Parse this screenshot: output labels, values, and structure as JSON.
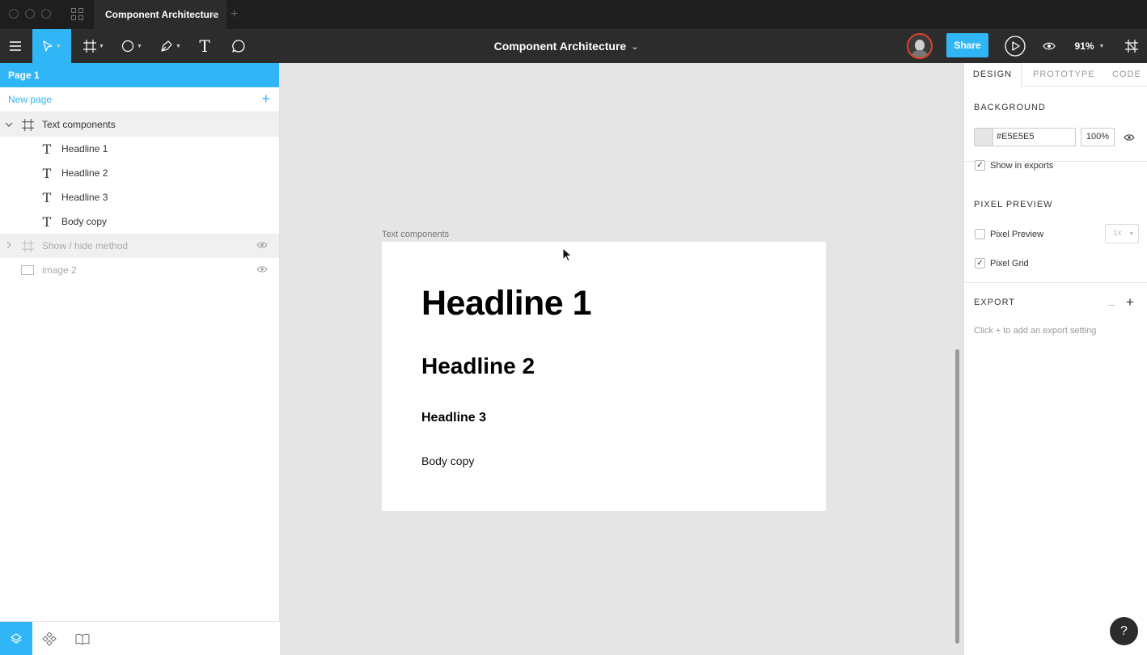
{
  "titlebar": {
    "tab_title": "Component Architecture",
    "tab_close": "×",
    "new_tab": "+"
  },
  "toolbar": {
    "file_title": "Component Architecture",
    "file_title_caret": "⌄",
    "share_label": "Share",
    "zoom_label": "91%",
    "accent_color": "#30B6F7"
  },
  "sidebar": {
    "page_label": "Page 1",
    "new_page_label": "New page",
    "layers": [
      {
        "label": "Text components",
        "type": "frame",
        "expanded": true
      },
      {
        "label": "Headline 1",
        "type": "text"
      },
      {
        "label": "Headline 2",
        "type": "text"
      },
      {
        "label": "Headline 3",
        "type": "text"
      },
      {
        "label": "Body copy",
        "type": "text"
      },
      {
        "label": "Show / hide method",
        "type": "frame",
        "expanded": false,
        "hidden": true
      },
      {
        "label": "image 2",
        "type": "image",
        "hidden": true
      }
    ]
  },
  "canvas": {
    "frame_label": "Text components",
    "headline_1": "Headline 1",
    "headline_2": "Headline 2",
    "headline_3": "Headline 3",
    "body_copy": "Body copy"
  },
  "design_panel": {
    "tabs": [
      "DESIGN",
      "PROTOTYPE",
      "CODE"
    ],
    "active_tab": "DESIGN",
    "background": {
      "title": "BACKGROUND",
      "hex": "#E5E5E5",
      "opacity": "100%",
      "show_in_exports_label": "Show in exports",
      "show_in_exports": true
    },
    "pixel_preview": {
      "title": "PIXEL PREVIEW",
      "pixel_preview_label": "Pixel Preview",
      "pixel_preview_checked": false,
      "scale": "1x",
      "pixel_grid_label": "Pixel Grid",
      "pixel_grid_checked": true
    },
    "export": {
      "title": "EXPORT",
      "hint": "Click + to add an export setting",
      "minus": "–",
      "plus": "+"
    }
  },
  "help_label": "?"
}
